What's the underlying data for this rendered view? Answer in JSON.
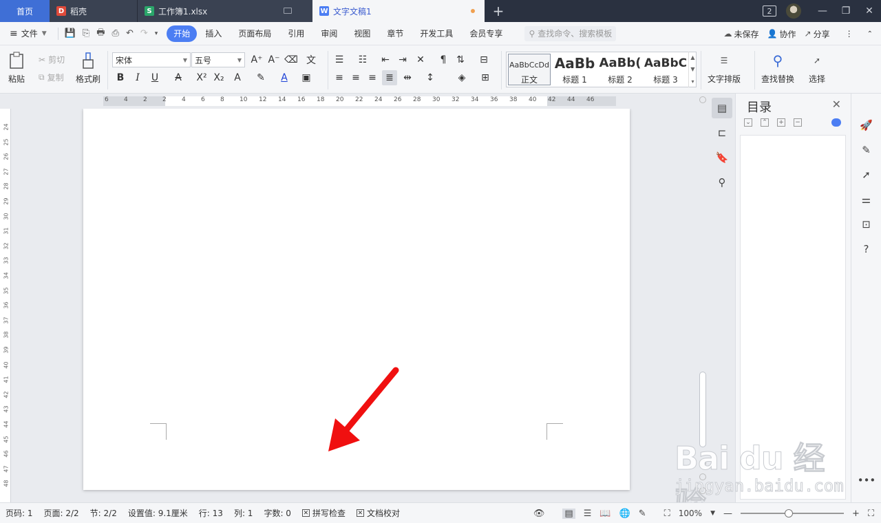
{
  "tabs": [
    {
      "label": "首页"
    },
    {
      "label": "稻壳"
    },
    {
      "label": "工作簿1.xlsx"
    },
    {
      "label": "文字文稿1"
    }
  ],
  "window": {
    "badge": "2"
  },
  "menu": {
    "file": "文件",
    "items": [
      "开始",
      "插入",
      "页面布局",
      "引用",
      "审阅",
      "视图",
      "章节",
      "开发工具",
      "会员专享"
    ],
    "search_placeholder": "查找命令、搜索模板",
    "unsaved": "未保存",
    "collab": "协作",
    "share": "分享"
  },
  "ribbon": {
    "paste": "粘贴",
    "cut": "剪切",
    "copy": "复制",
    "format_painter": "格式刷",
    "font_name": "宋体",
    "font_size": "五号",
    "styles": [
      {
        "preview": "AaBbCcDd",
        "label": "正文"
      },
      {
        "preview": "AaBb",
        "label": "标题 1"
      },
      {
        "preview": "AaBb(",
        "label": "标题 2"
      },
      {
        "preview": "AaBbC",
        "label": "标题 3"
      }
    ],
    "text_layout": "文字排版",
    "find_replace": "查找替换",
    "select": "选择"
  },
  "ruler": {
    "h_ticks": [
      "6",
      "4",
      "2",
      "2",
      "4",
      "6",
      "8",
      "10",
      "12",
      "14",
      "16",
      "18",
      "20",
      "22",
      "24",
      "26",
      "28",
      "30",
      "32",
      "34",
      "36",
      "38",
      "40",
      "42",
      "44",
      "46"
    ],
    "v_ticks": [
      "24",
      "25",
      "26",
      "27",
      "28",
      "29",
      "30",
      "31",
      "32",
      "33",
      "34",
      "35",
      "36",
      "37",
      "38",
      "39",
      "40",
      "41",
      "42",
      "43",
      "44",
      "45",
      "46",
      "47",
      "48"
    ]
  },
  "toc": {
    "title": "目录"
  },
  "status": {
    "page": "页码: 1",
    "pages": "页面: 2/2",
    "section": "节: 2/2",
    "setting": "设置值: 9.1厘米",
    "row": "行: 13",
    "col": "列: 1",
    "words": "字数: 0",
    "spell": "拼写检查",
    "proof": "文档校对",
    "zoom": "100%"
  },
  "colors": {
    "accent": "#4c7ef3",
    "arrow": "#f01010",
    "tabbar": "#2a3140"
  },
  "watermark": {
    "line1": "Bai du 经验",
    "line2": "jingyan.baidu.com"
  }
}
